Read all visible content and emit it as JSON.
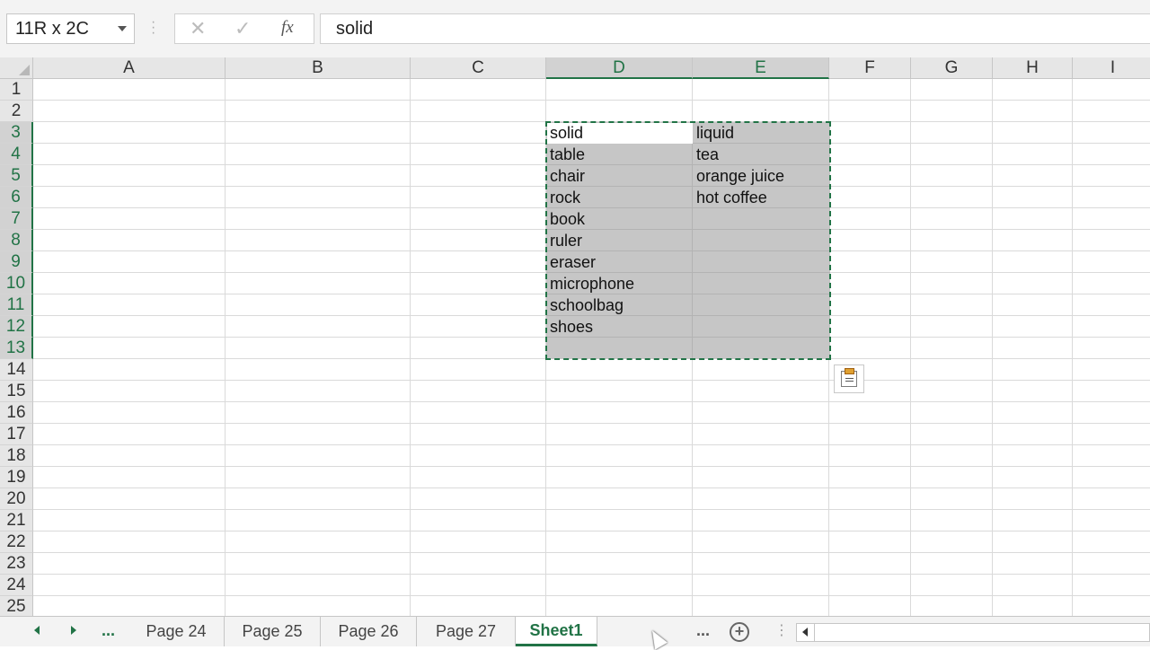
{
  "formula_bar": {
    "name_box": "11R x 2C",
    "cancel_icon": "close-icon",
    "enter_icon": "checkmark-icon",
    "fx_label": "fx",
    "formula_value": "solid"
  },
  "columns": [
    "A",
    "B",
    "C",
    "D",
    "E",
    "F",
    "G",
    "H",
    "I"
  ],
  "selected_columns": [
    "D",
    "E"
  ],
  "rows": [
    "1",
    "2",
    "3",
    "4",
    "5",
    "6",
    "7",
    "8",
    "9",
    "10",
    "11",
    "12",
    "13",
    "14",
    "15",
    "16",
    "17",
    "18",
    "19",
    "20",
    "21",
    "22",
    "23",
    "24",
    "25"
  ],
  "selected_rows": [
    "3",
    "4",
    "5",
    "6",
    "7",
    "8",
    "9",
    "10",
    "11",
    "12",
    "13"
  ],
  "cells": {
    "D": [
      "solid",
      "table",
      "chair",
      "rock",
      "book",
      "ruler",
      "eraser",
      "microphone",
      "schoolbag",
      "shoes"
    ],
    "E": [
      "liquid",
      "tea",
      "orange juice",
      "hot coffee"
    ]
  },
  "paste_options_icon": "paste-options-icon",
  "sheet_tabs": {
    "more_left": "...",
    "tabs": [
      "Page 24",
      "Page 25",
      "Page 26",
      "Page 27",
      "Sheet1"
    ],
    "active": "Sheet1",
    "more_right": "...",
    "add_icon": "plus-circle-icon"
  },
  "colors": {
    "accent": "#217346",
    "selection": "#c6c6c6",
    "header_bg": "#e6e6e6"
  }
}
